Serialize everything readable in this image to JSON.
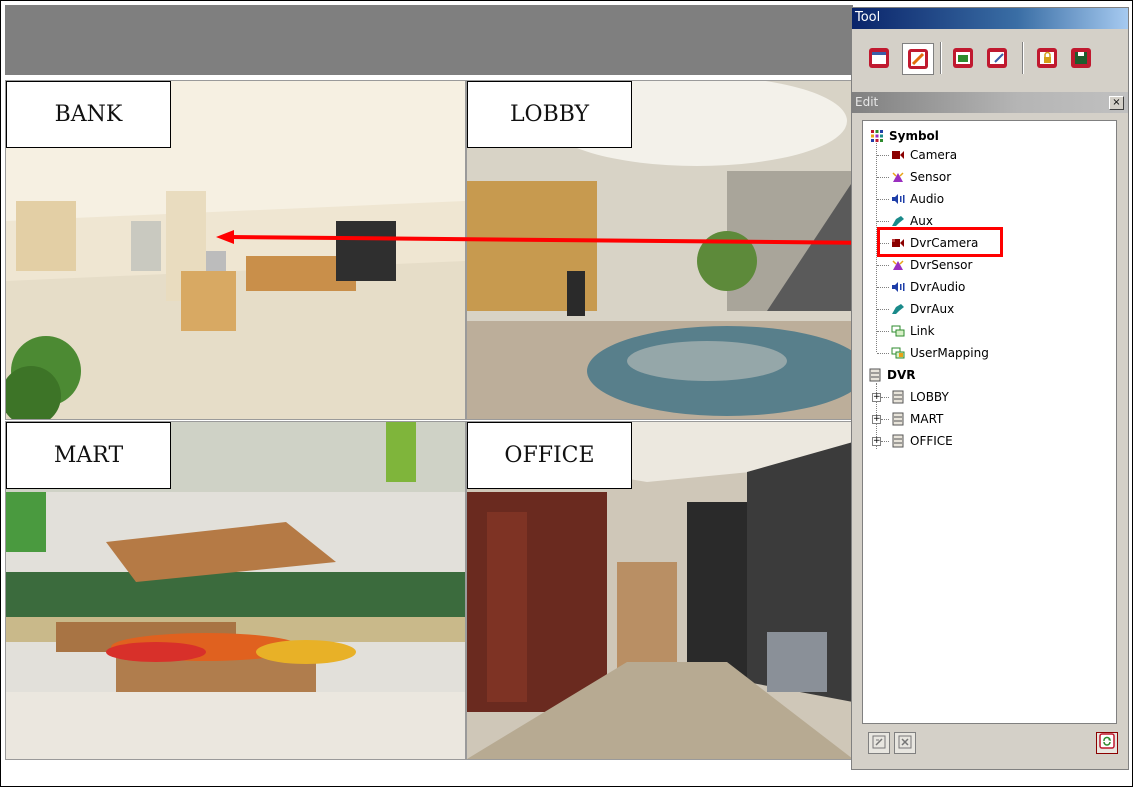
{
  "views": [
    {
      "id": "bank",
      "label": "BANK"
    },
    {
      "id": "lobby",
      "label": "LOBBY"
    },
    {
      "id": "mart",
      "label": "MART"
    },
    {
      "id": "office",
      "label": "OFFICE"
    }
  ],
  "tool_window": {
    "title": "Tool",
    "edit_title": "Edit",
    "close_glyph": "×",
    "toolbar_icons": [
      "window-icon",
      "edit-pencil-icon",
      "image-icon",
      "edit-form-icon",
      "lock-icon",
      "save-icon"
    ]
  },
  "tree": {
    "symbol_root": "Symbol",
    "symbol_items": [
      "Camera",
      "Sensor",
      "Audio",
      "Aux",
      "DvrCamera",
      "DvrSensor",
      "DvrAudio",
      "DvrAux",
      "Link",
      "UserMapping"
    ],
    "dvr_root": "DVR",
    "dvr_items": [
      "LOBBY",
      "MART",
      "OFFICE"
    ],
    "expander_glyph": "+"
  },
  "colors": {
    "highlight": "#ff0000",
    "icon_red": "#8b0000",
    "icon_purple": "#9a2fbf",
    "icon_blue": "#1e3ea8",
    "icon_teal": "#1a8a8a",
    "icon_green": "#2e8b2e"
  }
}
